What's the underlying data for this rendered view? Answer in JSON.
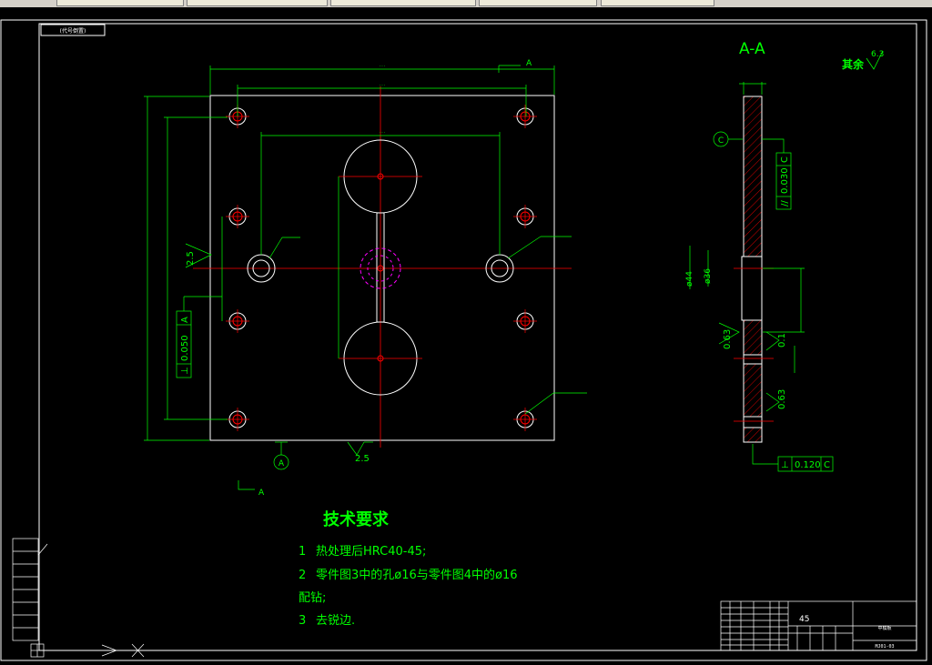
{
  "title_stamp": "(代号倒置)",
  "view": {
    "section_label": "A-A",
    "cut_arrow_top": "A",
    "cut_arrow_bottom": "A",
    "datum_a": "A",
    "datum_c": "C"
  },
  "roughness": {
    "other_label": "其余",
    "other_value": "6.3",
    "bottom_plate": "2.5",
    "left_plate": "2.5",
    "section_left": "0.63",
    "section_right_top": "0.1",
    "section_right_bottom": "0.63"
  },
  "tolerances": {
    "perpendicularity_left": {
      "symbol": "⊥",
      "value": "0.050",
      "datum": "A"
    },
    "parallelism_section": {
      "symbol": "//",
      "value": "0.030",
      "datum": "C"
    },
    "perpendicularity_section": {
      "symbol": "⊥",
      "value": "0.120",
      "datum": "C"
    }
  },
  "section_dims": {
    "bore_44": "ø44",
    "bore_36": "ø36"
  },
  "tech_requirements": {
    "heading": "技术要求",
    "items": [
      {
        "num": "1",
        "text": "热处理后HRC40-45;"
      },
      {
        "num": "2",
        "text": "零件图3中的孔ø16与零件图4中的ø16"
      },
      {
        "num": "",
        "text": "配钻;"
      },
      {
        "num": "3",
        "text": "去锐边."
      }
    ]
  },
  "title_block": {
    "material": "45",
    "part_name": "中模板",
    "drawing_no": "MJ01-03"
  },
  "colors": {
    "background": "#000000",
    "frame": "#ffffff",
    "dimension": "#00ff00",
    "centerline": "#ff0000",
    "hatch": "#ff0000",
    "hidden": "#ff00ff",
    "annotation": "#00ff00"
  }
}
